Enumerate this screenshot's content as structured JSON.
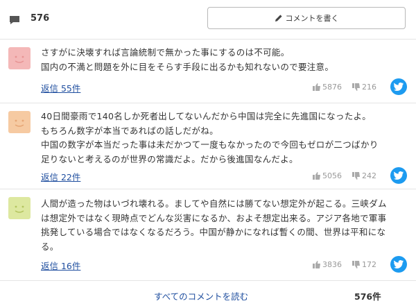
{
  "header": {
    "comment_count": "576",
    "write_button_label": "コメントを書く"
  },
  "comments": [
    {
      "avatar_color": "#f4b8b8",
      "avatar_face_color": "#e79494",
      "lines": [
        "さすがに決壊すれば言論統制で無かった事にするのは不可能。",
        "国内の不満と問題を外に目をそらす手段に出るかも知れないので要注意。"
      ],
      "reply_label": "返信 55件",
      "likes": "5876",
      "dislikes": "216"
    },
    {
      "avatar_color": "#f6caa2",
      "avatar_face_color": "#e6a574",
      "lines": [
        "40日間豪雨で140名しか死者出してないんだから中国は完全に先進国になったよ。",
        "もちろん数字が本当であればの話しだがね。",
        "中国の数字が本当だった事は未だかつて一度もなかったので今回もゼロが二つばかり",
        "足りないと考えるのが世界の常識だよ。だから後進国なんだよ。"
      ],
      "reply_label": "返信 22件",
      "likes": "5056",
      "dislikes": "242"
    },
    {
      "avatar_color": "#dde8a0",
      "avatar_face_color": "#b3c45e",
      "lines": [
        "人間が造った物はいづれ壊れる。ましてや自然には勝てない想定外が起こる。三峡ダム",
        "は想定外ではなく現時点でどんな災害になるか、およそ想定出来る。アジア各地で軍事",
        "挑発している場合ではなくなるだろう。中国が静かになれば暫くの間、世界は平和にな",
        "る。"
      ],
      "reply_label": "返信 16件",
      "likes": "3836",
      "dislikes": "172"
    }
  ],
  "footer": {
    "all_comments_label": "すべてのコメントを読む",
    "total_label": "576件"
  },
  "colors": {
    "link": "#1f4e9f",
    "twitter": "#1d9bf0"
  }
}
